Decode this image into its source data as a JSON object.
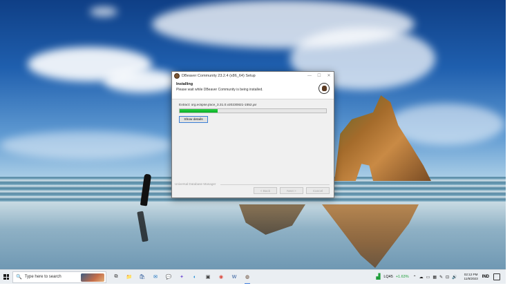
{
  "installer": {
    "title": "DBeaver Community 23.2.4 (x86_64) Setup",
    "header_title": "Installing",
    "header_subtitle": "Please wait while DBeaver Community is being installed.",
    "extract_text": "Extract: org.eclipse.jface_3.31.0.v20230821-1552.jar",
    "progress": 0.26,
    "show_details_label": "Show details",
    "footer_label": "Universal Database Manager",
    "back_label": "< Back",
    "next_label": "Next >",
    "cancel_label": "Cancel",
    "minimize": "—",
    "maximize": "☐",
    "close": "✕"
  },
  "taskbar": {
    "search_placeholder": "Type here to search",
    "search_icon": "🔍",
    "icons": [
      {
        "name": "task-view-icon",
        "glyph": "⧉",
        "color": "#333333"
      },
      {
        "name": "file-explorer-icon",
        "glyph": "📁",
        "color": "#e8b000"
      },
      {
        "name": "store-icon",
        "glyph": "🛍",
        "color": "#2b5797"
      },
      {
        "name": "mail-icon",
        "glyph": "✉",
        "color": "#0f6cbd"
      },
      {
        "name": "chat-icon",
        "glyph": "💬",
        "color": "#4b53bc"
      },
      {
        "name": "copilot-icon",
        "glyph": "✦",
        "color": "#7b58d6"
      },
      {
        "name": "edge-icon",
        "glyph": "◐",
        "color": "#1a8bd6"
      },
      {
        "name": "app-icon",
        "glyph": "▣",
        "color": "#333333"
      },
      {
        "name": "chrome-icon",
        "glyph": "◉",
        "color": "#db4437"
      },
      {
        "name": "word-icon",
        "glyph": "W",
        "color": "#2b579a"
      },
      {
        "name": "dbeaver-icon",
        "glyph": "◍",
        "color": "#5b3a22"
      }
    ],
    "stock_name": "LQ45",
    "stock_change": "+1.63%",
    "tray": [
      "⌃",
      "☁",
      "▭",
      "▦",
      "✎",
      "⊡",
      "🔊"
    ],
    "clock_time": "02:12 PM",
    "clock_date": "11/6/2023",
    "language": "IND"
  }
}
